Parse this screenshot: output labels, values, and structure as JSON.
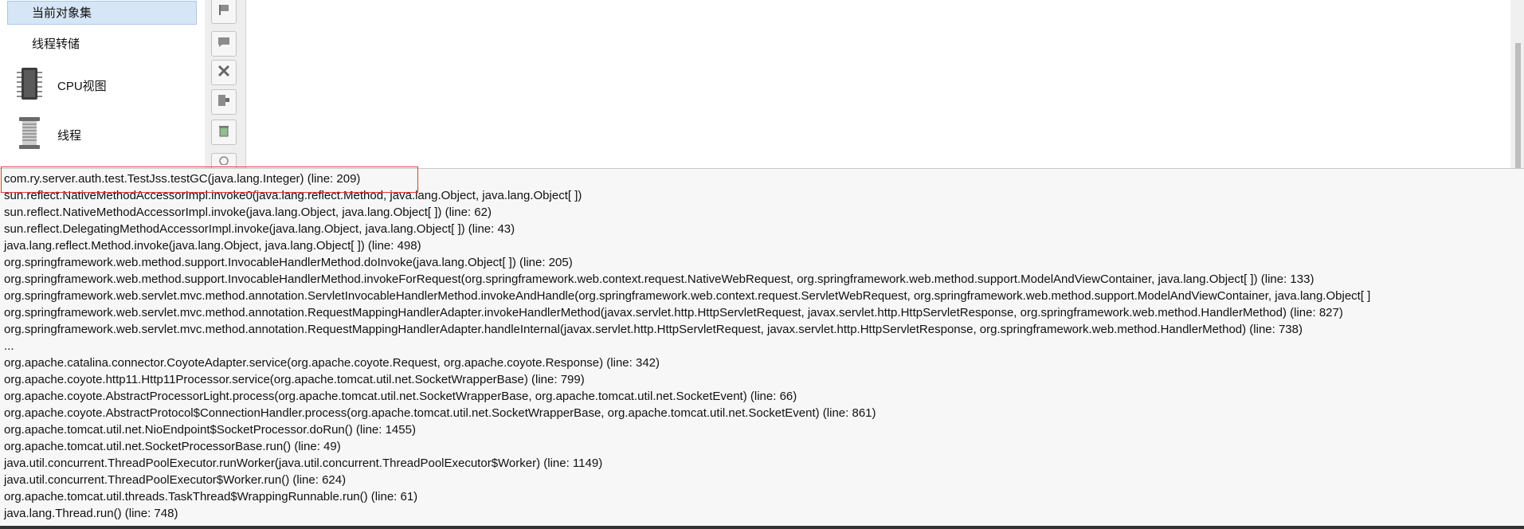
{
  "sidebar": {
    "selected_item": "当前对象集",
    "thread_dump": "线程转储",
    "cpu_view": "CPU视图",
    "threads": "线程"
  },
  "toolbar": {
    "icons": [
      "flag-icon",
      "comment-icon",
      "close-icon",
      "export-icon",
      "clear-icon",
      "circle-plus-icon"
    ]
  },
  "colors": {
    "highlight": "#e03b3b",
    "selected_bg": "#d6e6f7"
  },
  "stack_trace": [
    "com.ry.server.auth.test.TestJss.testGC(java.lang.Integer) (line: 209)",
    "sun.reflect.NativeMethodAccessorImpl.invoke0(java.lang.reflect.Method, java.lang.Object, java.lang.Object[ ])",
    "sun.reflect.NativeMethodAccessorImpl.invoke(java.lang.Object, java.lang.Object[ ]) (line: 62)",
    "sun.reflect.DelegatingMethodAccessorImpl.invoke(java.lang.Object, java.lang.Object[ ]) (line: 43)",
    "java.lang.reflect.Method.invoke(java.lang.Object, java.lang.Object[ ]) (line: 498)",
    "org.springframework.web.method.support.InvocableHandlerMethod.doInvoke(java.lang.Object[ ]) (line: 205)",
    "org.springframework.web.method.support.InvocableHandlerMethod.invokeForRequest(org.springframework.web.context.request.NativeWebRequest, org.springframework.web.method.support.ModelAndViewContainer, java.lang.Object[ ]) (line: 133)",
    "org.springframework.web.servlet.mvc.method.annotation.ServletInvocableHandlerMethod.invokeAndHandle(org.springframework.web.context.request.ServletWebRequest, org.springframework.web.method.support.ModelAndViewContainer, java.lang.Object[ ]",
    "org.springframework.web.servlet.mvc.method.annotation.RequestMappingHandlerAdapter.invokeHandlerMethod(javax.servlet.http.HttpServletRequest, javax.servlet.http.HttpServletResponse, org.springframework.web.method.HandlerMethod) (line: 827)",
    "org.springframework.web.servlet.mvc.method.annotation.RequestMappingHandlerAdapter.handleInternal(javax.servlet.http.HttpServletRequest, javax.servlet.http.HttpServletResponse, org.springframework.web.method.HandlerMethod) (line: 738)",
    "...",
    "org.apache.catalina.connector.CoyoteAdapter.service(org.apache.coyote.Request, org.apache.coyote.Response) (line: 342)",
    "org.apache.coyote.http11.Http11Processor.service(org.apache.tomcat.util.net.SocketWrapperBase) (line: 799)",
    "org.apache.coyote.AbstractProcessorLight.process(org.apache.tomcat.util.net.SocketWrapperBase, org.apache.tomcat.util.net.SocketEvent) (line: 66)",
    "org.apache.coyote.AbstractProtocol$ConnectionHandler.process(org.apache.tomcat.util.net.SocketWrapperBase, org.apache.tomcat.util.net.SocketEvent) (line: 861)",
    "org.apache.tomcat.util.net.NioEndpoint$SocketProcessor.doRun() (line: 1455)",
    "org.apache.tomcat.util.net.SocketProcessorBase.run() (line: 49)",
    "java.util.concurrent.ThreadPoolExecutor.runWorker(java.util.concurrent.ThreadPoolExecutor$Worker) (line: 1149)",
    "java.util.concurrent.ThreadPoolExecutor$Worker.run() (line: 624)",
    "org.apache.tomcat.util.threads.TaskThread$WrappingRunnable.run() (line: 61)",
    "java.lang.Thread.run() (line: 748)"
  ]
}
